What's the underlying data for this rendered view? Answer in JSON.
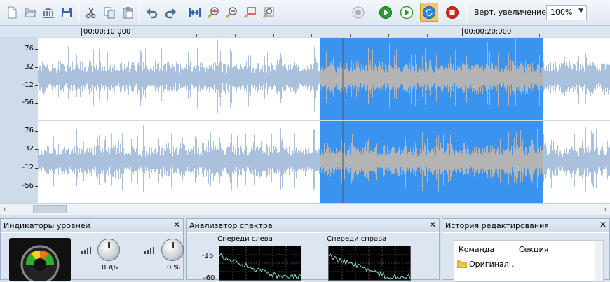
{
  "toolbar": {
    "buttons": [
      {
        "name": "new-file-icon"
      },
      {
        "name": "open-file-icon"
      },
      {
        "name": "library-icon"
      },
      {
        "name": "save-icon"
      },
      {
        "name": "cut-icon"
      },
      {
        "name": "copy-icon"
      },
      {
        "name": "paste-icon"
      },
      {
        "name": "undo-icon"
      },
      {
        "name": "redo-icon"
      },
      {
        "name": "fit-width-icon"
      },
      {
        "name": "zoom-in-icon"
      },
      {
        "name": "zoom-out-icon"
      },
      {
        "name": "zoom-selection-icon"
      },
      {
        "name": "zoom-fit-icon"
      },
      {
        "name": "stop-gray-icon"
      },
      {
        "name": "play-icon"
      },
      {
        "name": "play-selection-icon"
      },
      {
        "name": "loop-icon"
      },
      {
        "name": "record-stop-icon"
      }
    ],
    "vertical_zoom_label": "Верт. увеличение:",
    "vertical_zoom_value": "100%"
  },
  "timeline": {
    "ticks": [
      "00:00:10:000",
      "00:00:20:000"
    ]
  },
  "channels": [
    {
      "ylabels": [
        "76",
        "32",
        "-12",
        "-56"
      ]
    },
    {
      "ylabels": [
        "76",
        "32",
        "-12",
        "-56"
      ]
    }
  ],
  "panels": {
    "levels": {
      "title": "Индикаторы уровней",
      "knob1_value": "0 дБ",
      "knob2_value": "0 %"
    },
    "spectrum": {
      "title": "Анализатор спектра",
      "left_label": "Спереди слева",
      "right_label": "Спереди справа",
      "y_labels": [
        "-16",
        "-60"
      ]
    },
    "history": {
      "title": "История редактирования",
      "col_command": "Команда",
      "col_section": "Секция",
      "row1": "Оригинал..."
    }
  },
  "colors": {
    "wave": "#a9c1dc",
    "selection": "#3a93ee",
    "selection_wave": "#b4b4b4"
  }
}
